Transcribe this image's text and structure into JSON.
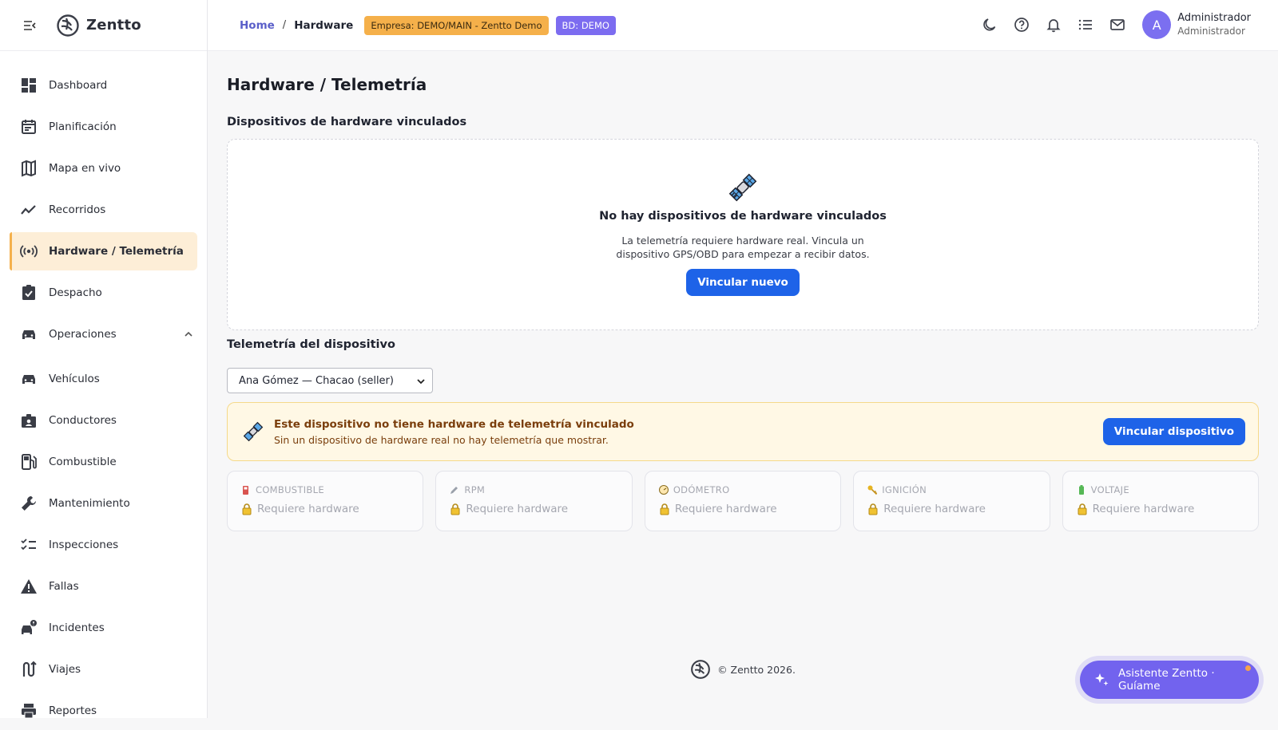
{
  "brand": {
    "name": "Zentto"
  },
  "sidebar": {
    "items": [
      {
        "label": "Dashboard",
        "icon": "dashboard-icon"
      },
      {
        "label": "Planificación",
        "icon": "calendar-icon"
      },
      {
        "label": "Mapa en vivo",
        "icon": "map-icon"
      },
      {
        "label": "Recorridos",
        "icon": "timeline-icon"
      },
      {
        "label": "Hardware / Telemetría",
        "icon": "broadcast-icon",
        "active": true
      },
      {
        "label": "Despacho",
        "icon": "clipboard-check-icon"
      },
      {
        "label": "Operaciones",
        "icon": "car-icon",
        "expanded": true
      },
      {
        "label": "Vehículos",
        "icon": "car-icon"
      },
      {
        "label": "Conductores",
        "icon": "badge-icon"
      },
      {
        "label": "Combustible",
        "icon": "fuel-pump-icon"
      },
      {
        "label": "Mantenimiento",
        "icon": "wrench-icon"
      },
      {
        "label": "Inspecciones",
        "icon": "checklist-icon"
      },
      {
        "label": "Fallas",
        "icon": "warning-icon"
      },
      {
        "label": "Incidentes",
        "icon": "car-crash-icon"
      },
      {
        "label": "Viajes",
        "icon": "route-icon"
      },
      {
        "label": "Reportes",
        "icon": "print-icon"
      }
    ]
  },
  "header": {
    "breadcrumb": {
      "home": "Home",
      "separator": "/",
      "current": "Hardware"
    },
    "empresa_badge": "Empresa: DEMO/MAIN - Zentto Demo",
    "bd_badge": "BD: DEMO",
    "icons": [
      "moon-icon",
      "help-icon",
      "bell-icon",
      "list-icon",
      "mail-icon"
    ],
    "user": {
      "initial": "A",
      "name": "Administrador",
      "role": "Administrador"
    }
  },
  "main": {
    "title": "Hardware / Telemetría",
    "linked_section": {
      "title": "Dispositivos de hardware vinculados",
      "empty_title": "No hay dispositivos de hardware vinculados",
      "empty_desc": "La telemetría requiere hardware real. Vincula un dispositivo GPS/OBD para empezar a recibir datos.",
      "button": "Vincular nuevo"
    },
    "telemetry_section": {
      "title": "Telemetría del dispositivo",
      "selected_device": "Ana Gómez — Chacao (seller)",
      "alert_title": "Este dispositivo no tiene hardware de telemetría vinculado",
      "alert_desc": "Sin un dispositivo de hardware real no hay telemetría que mostrar.",
      "alert_button": "Vincular dispositivo"
    },
    "metrics": [
      {
        "label": "COMBUSTIBLE",
        "icon": "fuel-icon",
        "value": "Requiere hardware"
      },
      {
        "label": "RPM",
        "icon": "pencil-icon",
        "value": "Requiere hardware"
      },
      {
        "label": "ODÓMETRO",
        "icon": "gauge-icon",
        "value": "Requiere hardware"
      },
      {
        "label": "IGNICIÓN",
        "icon": "key-icon",
        "value": "Requiere hardware"
      },
      {
        "label": "VOLTAJE",
        "icon": "battery-icon",
        "value": "Requiere hardware"
      }
    ]
  },
  "footer": {
    "text": "© Zentto 2026."
  },
  "assistant": {
    "label": "Asistente Zentto · Guíame"
  },
  "colors": {
    "primary": "#1e63e8",
    "accent": "#7c6cf0",
    "warning_bg": "#fff8e5",
    "active_bg": "#fdeed7"
  }
}
